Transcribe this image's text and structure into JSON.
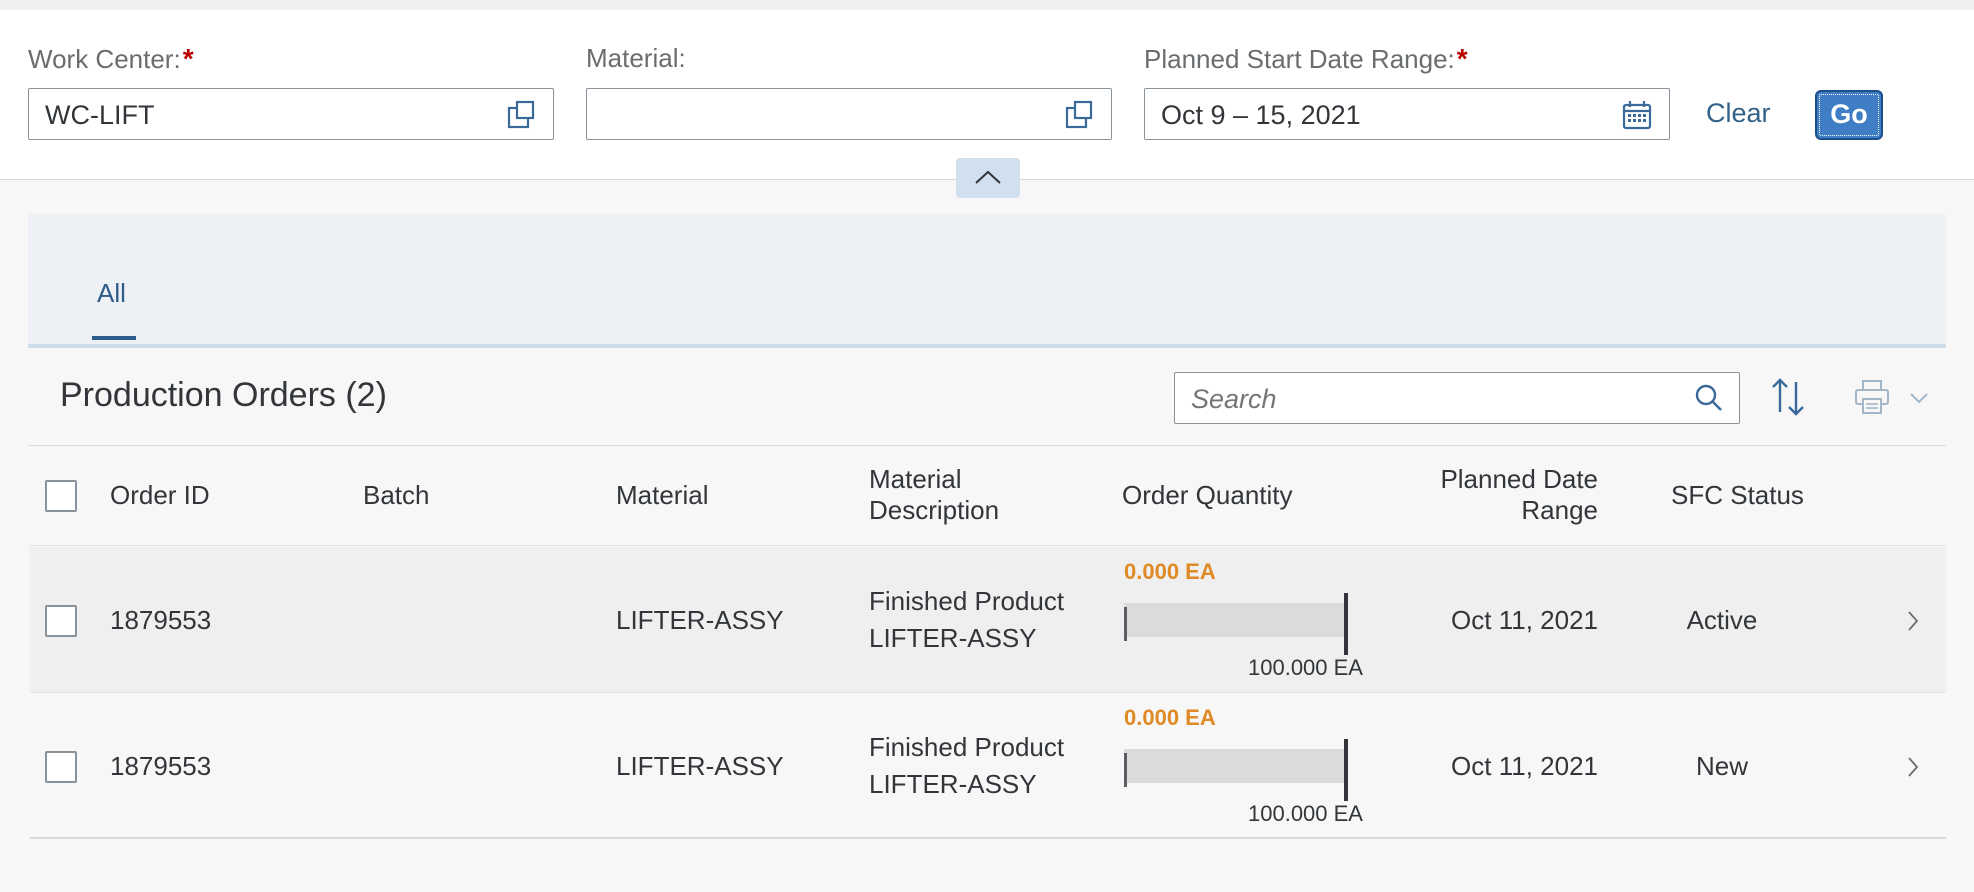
{
  "filters": {
    "work_center": {
      "label": "Work Center:",
      "required_mark": "*",
      "value": "WC-LIFT"
    },
    "material": {
      "label": "Material:",
      "value": ""
    },
    "date_range": {
      "label": "Planned Start Date Range:",
      "required_mark": "*",
      "value": "Oct 9 – 15, 2021"
    },
    "clear_label": "Clear",
    "go_label": "Go"
  },
  "tabs": [
    {
      "label": "All",
      "selected": true
    }
  ],
  "table": {
    "title": "Production Orders (2)",
    "search_placeholder": "Search",
    "columns": {
      "order_id": "Order ID",
      "batch": "Batch",
      "material": "Material",
      "material_desc_line1": "Material",
      "material_desc_line2": "Description",
      "order_quantity": "Order Quantity",
      "planned_line1": "Planned Date",
      "planned_line2": "Range",
      "sfc_status": "SFC Status"
    },
    "rows": [
      {
        "order_id": "1879553",
        "batch": "",
        "material": "LIFTER-ASSY",
        "desc_line1": "Finished Product",
        "desc_line2": "LIFTER-ASSY",
        "qty_done": "0.000 EA",
        "qty_total": "100.000 EA",
        "planned_date": "Oct 11, 2021",
        "sfc_status": "Active"
      },
      {
        "order_id": "1879553",
        "batch": "",
        "material": "LIFTER-ASSY",
        "desc_line1": "Finished Product",
        "desc_line2": "LIFTER-ASSY",
        "qty_done": "0.000 EA",
        "qty_total": "100.000 EA",
        "planned_date": "Oct 11, 2021",
        "sfc_status": "New"
      }
    ]
  },
  "colors": {
    "accent": "#346187",
    "required": "#bb0000",
    "quantity_highlight": "#df8a25"
  },
  "icons": [
    "value-help-icon",
    "calendar-icon",
    "collapse-icon",
    "search-icon",
    "sort-icon",
    "print-icon",
    "chevron-down-icon",
    "chevron-right-icon"
  ]
}
